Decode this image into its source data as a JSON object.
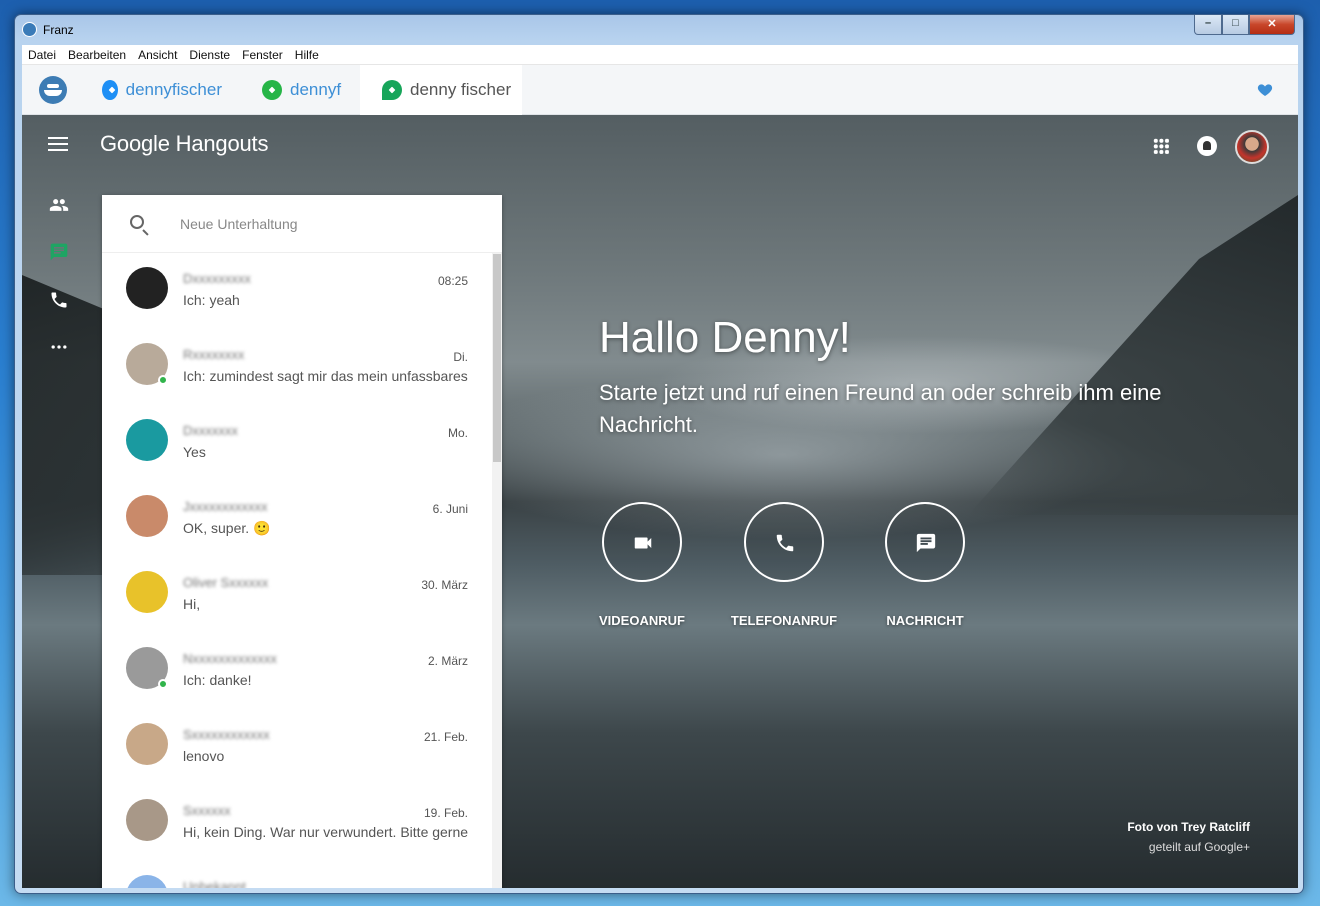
{
  "window": {
    "title": "Franz"
  },
  "menu": [
    "Datei",
    "Bearbeiten",
    "Ansicht",
    "Dienste",
    "Fenster",
    "Hilfe"
  ],
  "tabs": [
    {
      "label": "dennyfischer",
      "icon": "messenger-icon"
    },
    {
      "label": "dennyf",
      "icon": "whatsapp-icon"
    },
    {
      "label": "denny fischer",
      "icon": "hangouts-icon",
      "active": true
    }
  ],
  "hangouts": {
    "logo_google": "Google",
    "logo_product": "Hangouts",
    "search": {
      "placeholder": "Neue Unterhaltung",
      "value": ""
    },
    "conversations": [
      {
        "name": "Dxxxxxxxxx",
        "time": "08:25",
        "message": "Ich: yeah",
        "online": false,
        "avatar_color": "#222222"
      },
      {
        "name": "Rxxxxxxxx",
        "time": "Di.",
        "message": "Ich: zumindest sagt mir das mein unfassbares",
        "online": true,
        "avatar_color": "#b8aa9a"
      },
      {
        "name": "Dxxxxxxx",
        "time": "Mo.",
        "message": "Yes",
        "online": false,
        "avatar_color": "#1a9aa0"
      },
      {
        "name": "Jxxxxxxxxxxxx",
        "time": "6. Juni",
        "message": "OK, super. 🙂",
        "online": false,
        "avatar_color": "#c98a6a"
      },
      {
        "name": "Oliver Sxxxxxx",
        "time": "30. März",
        "message": "Hi,",
        "online": false,
        "avatar_color": "#e8c22a"
      },
      {
        "name": "Nxxxxxxxxxxxxx",
        "time": "2. März",
        "message": "Ich: danke!",
        "online": true,
        "avatar_color": "#9a9a9a"
      },
      {
        "name": "Sxxxxxxxxxxxx",
        "time": "21. Feb.",
        "message": "lenovo",
        "online": false,
        "avatar_color": "#c8a888"
      },
      {
        "name": "Sxxxxxx",
        "time": "19. Feb.",
        "message": "Hi, kein Ding. War nur verwundert. Bitte gerne",
        "online": false,
        "avatar_color": "#a89888"
      },
      {
        "name": "Unbekannt",
        "time": "",
        "message": "",
        "online": false,
        "avatar_color": "#8ab4e8"
      }
    ],
    "greeting": "Hallo Denny!",
    "subtitle": "Starte jetzt und ruf einen Freund an oder schreib ihm eine Nachricht.",
    "actions": [
      {
        "label": "VIDEOANRUF",
        "icon": "videocam-icon"
      },
      {
        "label": "TELEFONANRUF",
        "icon": "phone-icon"
      },
      {
        "label": "NACHRICHT",
        "icon": "message-icon"
      }
    ],
    "photo_credit": "Foto von Trey Ratcliff",
    "photo_shared": "geteilt auf Google+"
  }
}
